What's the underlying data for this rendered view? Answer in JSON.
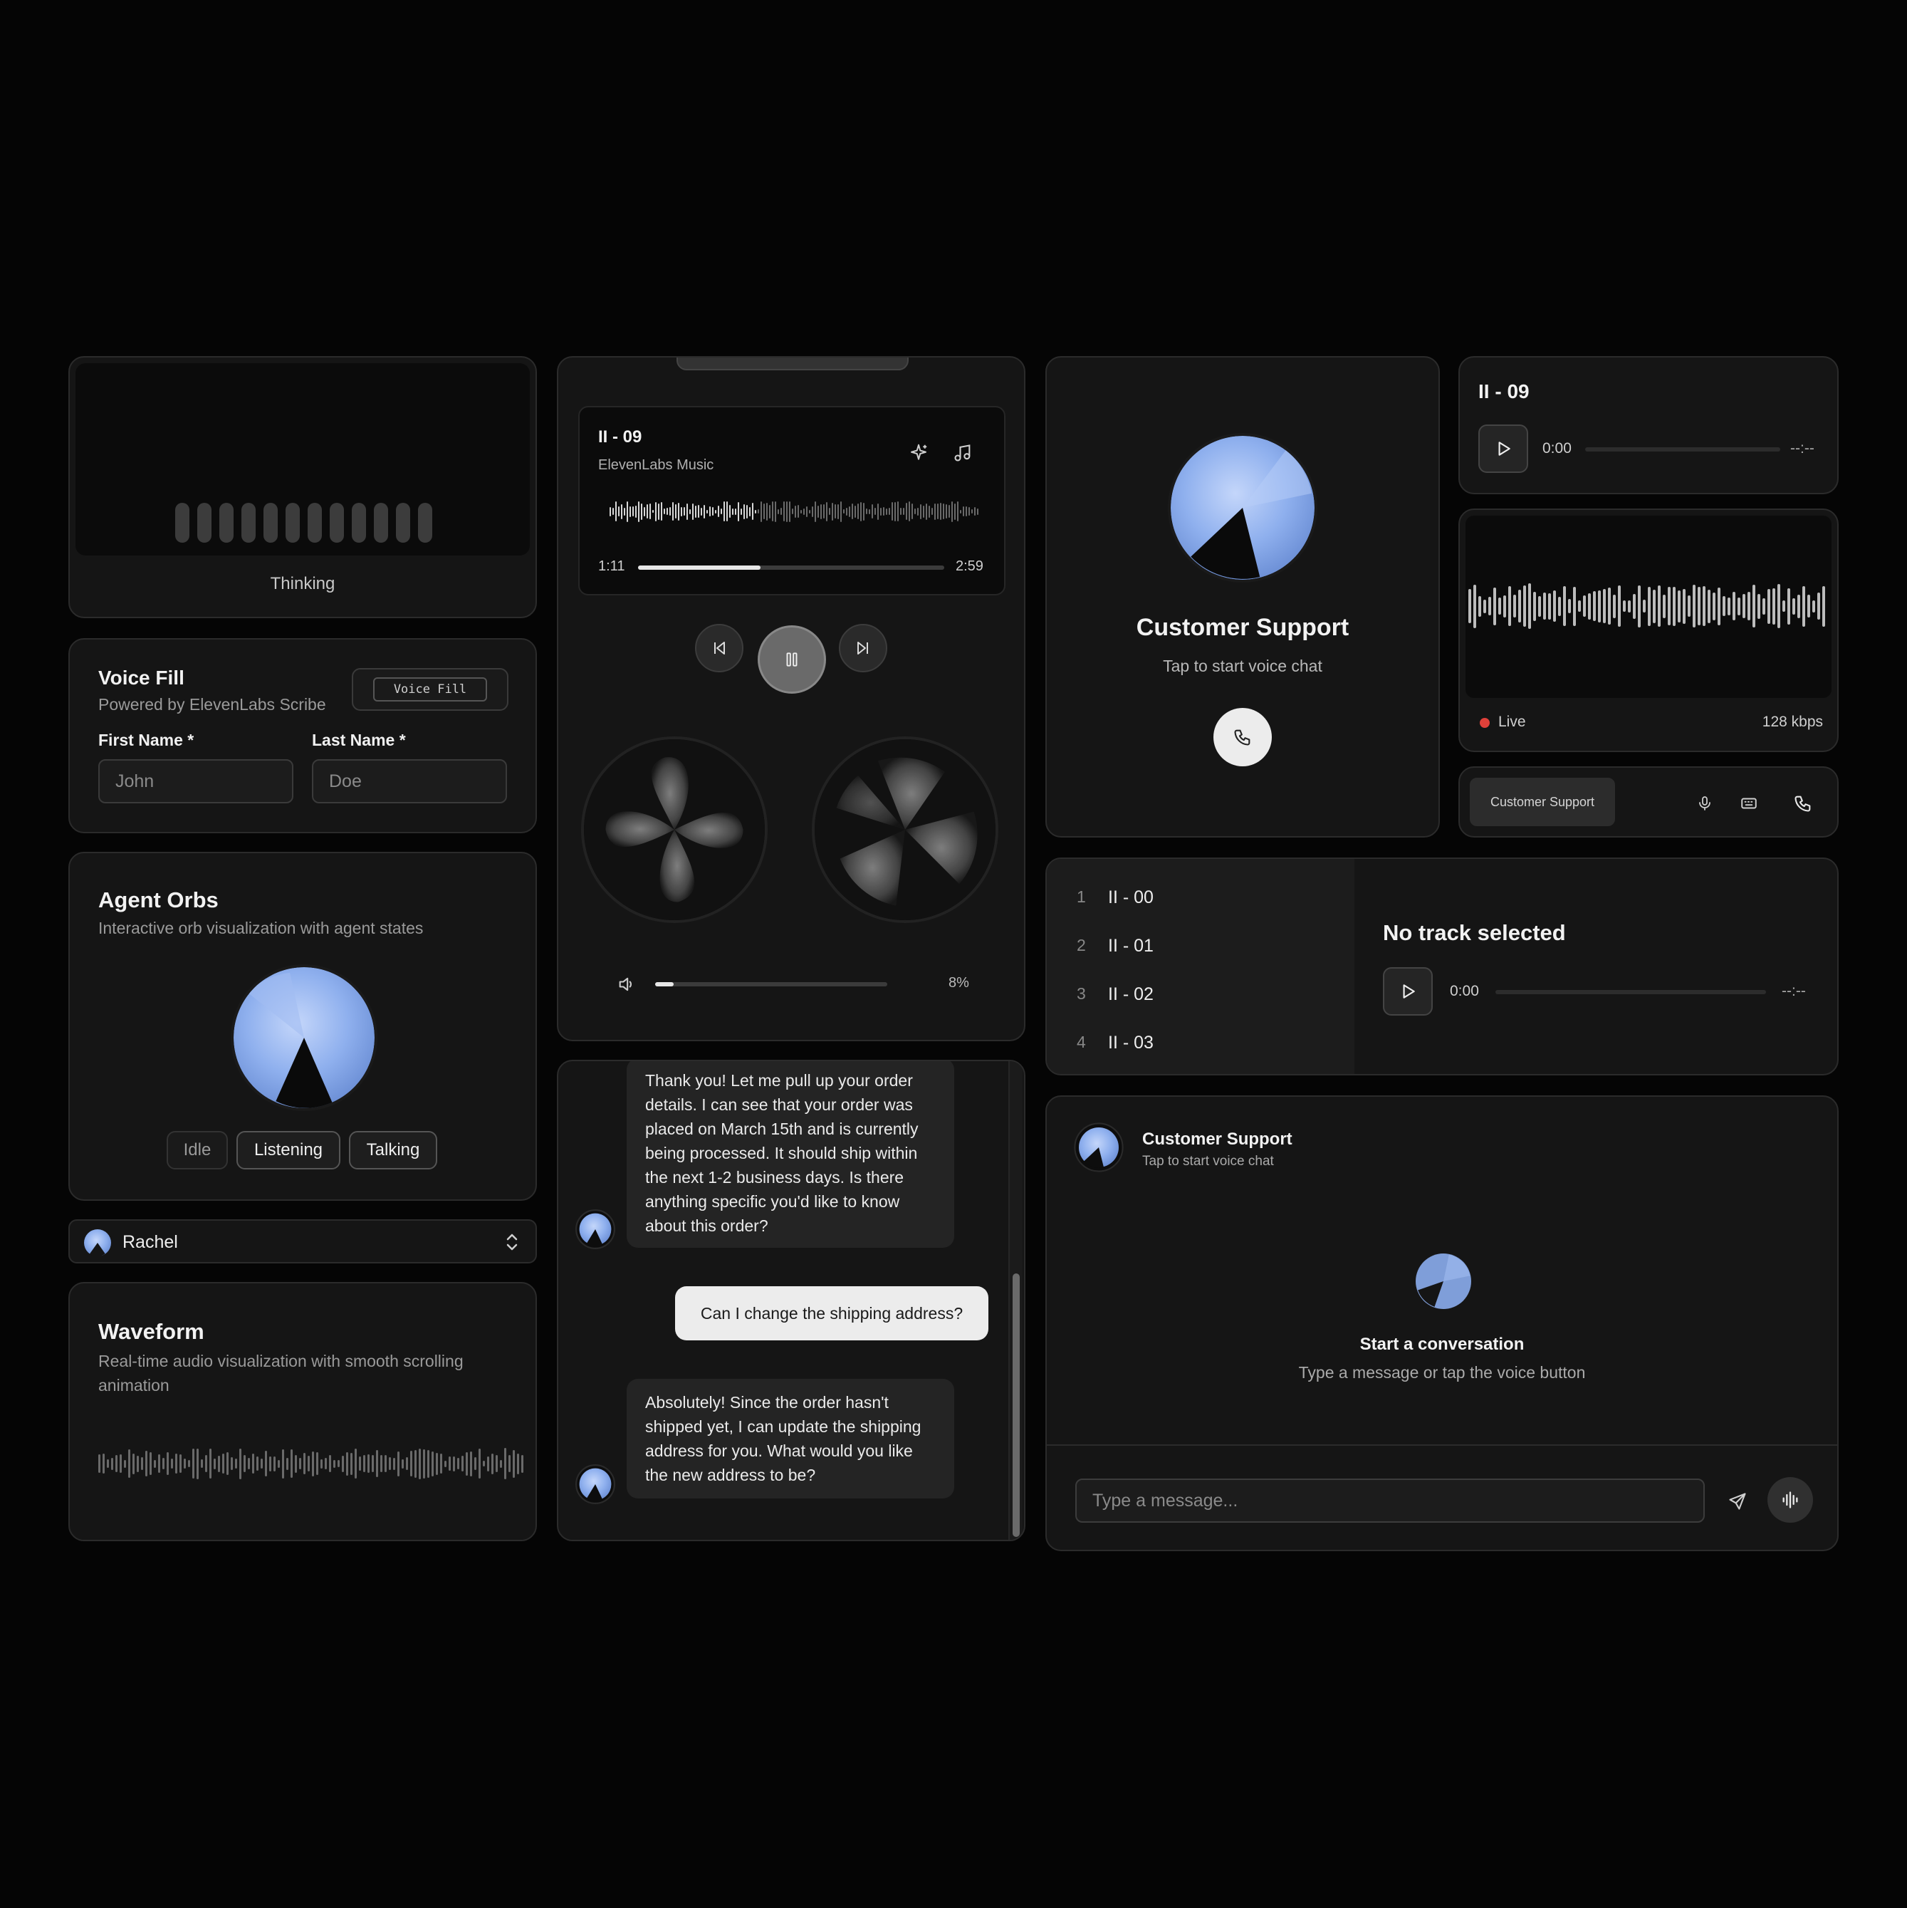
{
  "thinking": {
    "status": "Thinking"
  },
  "voice_fill": {
    "title": "Voice Fill",
    "subtitle": "Powered by ElevenLabs Scribe",
    "button": "Voice Fill",
    "first_label": "First Name *",
    "first_placeholder": "John",
    "last_label": "Last Name *",
    "last_placeholder": "Doe"
  },
  "agent_orbs": {
    "title": "Agent Orbs",
    "subtitle": "Interactive orb visualization with agent states",
    "states": [
      "Idle",
      "Listening",
      "Talking"
    ]
  },
  "voice_select": {
    "value": "Rachel"
  },
  "waveform": {
    "title": "Waveform",
    "subtitle": "Real-time audio visualization with smooth scrolling animation"
  },
  "player": {
    "track": "II - 09",
    "artist": "ElevenLabs Music",
    "elapsed": "1:11",
    "duration": "2:59",
    "progress": 0.4,
    "volume_label": "8%",
    "volume": 0.08
  },
  "chat": {
    "msg1": "Thank you! Let me pull up your order details. I can see that your order was placed on March 15th and is currently being processed. It should ship within the next 1-2 business days. Is there anything specific you'd like to know about this order?",
    "msg2": "Can I change the shipping address?",
    "msg3": "Absolutely! Since the order hasn't shipped yet, I can update the shipping address for you. What would you like the new address to be?"
  },
  "support_card": {
    "title": "Customer Support",
    "subtitle": "Tap to start voice chat"
  },
  "mini_player": {
    "track": "II - 09",
    "time": "0:00",
    "duration": "--:--"
  },
  "live": {
    "status": "Live",
    "bitrate": "128 kbps"
  },
  "call_bar": {
    "label": "Customer Support"
  },
  "tracklist": {
    "items": [
      {
        "num": "1",
        "name": "II - 00"
      },
      {
        "num": "2",
        "name": "II - 01"
      },
      {
        "num": "3",
        "name": "II - 02"
      },
      {
        "num": "4",
        "name": "II - 03"
      }
    ],
    "empty_title": "No track selected",
    "time": "0:00",
    "duration": "--:--"
  },
  "conversation": {
    "header_title": "Customer Support",
    "header_subtitle": "Tap to start voice chat",
    "empty_title": "Start a conversation",
    "empty_subtitle": "Type a message or tap the voice button",
    "input_placeholder": "Type a message..."
  },
  "colors": {
    "accent": "#a9c4f5",
    "orb_blue": "#8fb0ee",
    "live_red": "#e0413a"
  }
}
